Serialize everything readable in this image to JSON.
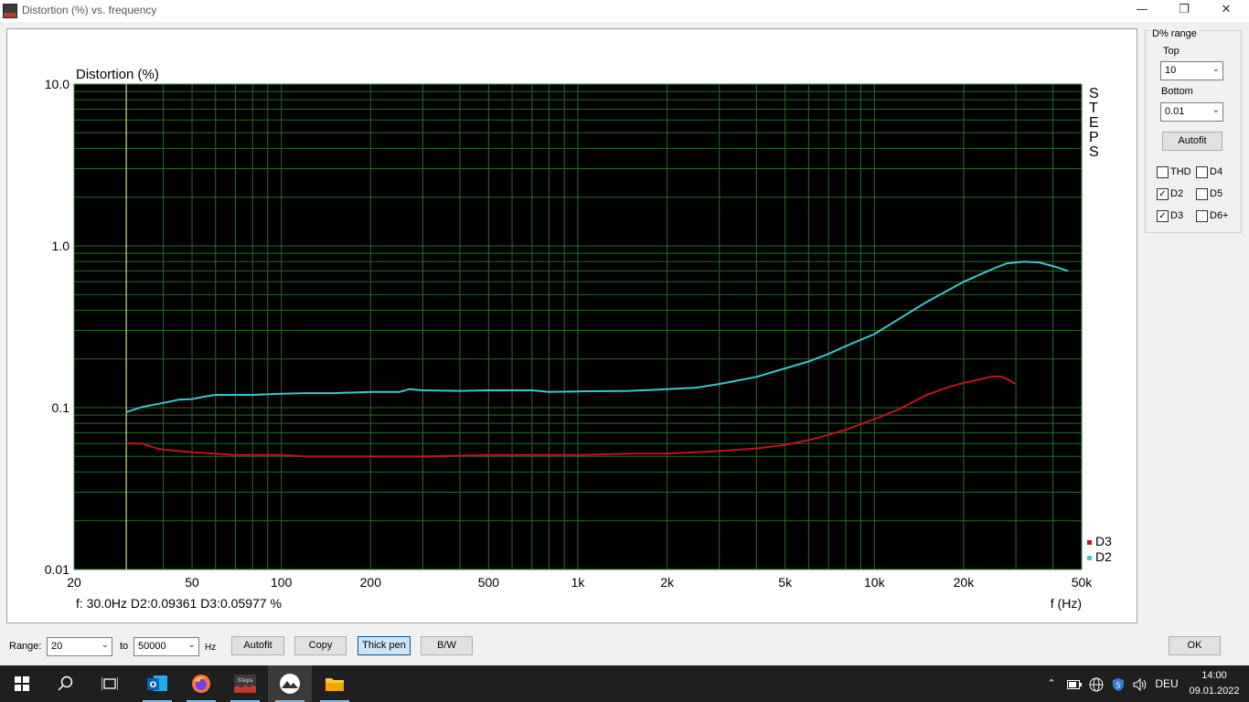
{
  "window": {
    "title": "Distortion (%) vs. frequency",
    "minimize": "—",
    "maximize": "❐",
    "close": "✕"
  },
  "chart_data": {
    "type": "line",
    "title": "Distortion (%)",
    "xlabel": "f (Hz)",
    "ylabel": "Distortion (%)",
    "xscale": "log",
    "yscale": "log",
    "xlim": [
      20,
      50000
    ],
    "ylim": [
      0.01,
      10
    ],
    "x_ticks": [
      20,
      50,
      100,
      200,
      500,
      1000,
      2000,
      5000,
      10000,
      20000,
      50000
    ],
    "x_tick_labels": [
      "20",
      "50",
      "100",
      "200",
      "500",
      "1k",
      "2k",
      "5k",
      "10k",
      "20k",
      "50k"
    ],
    "y_ticks": [
      0.01,
      0.1,
      1,
      10
    ],
    "y_tick_labels": [
      "0.01",
      "0.1",
      "1.0",
      "10.0"
    ],
    "grid": true,
    "background": "#000000",
    "gridcolor": "#2a6b2a",
    "watermark": "STEPS",
    "cursor": {
      "x": 30,
      "readout": "f: 30.0Hz     D2:0.09361   D3:0.05977 %"
    },
    "legend": "bottom-right",
    "series": [
      {
        "name": "D2",
        "color": "#3cc8c8",
        "x": [
          30,
          34,
          40,
          45,
          50,
          55,
          60,
          80,
          100,
          120,
          150,
          200,
          250,
          270,
          300,
          400,
          500,
          700,
          800,
          1000,
          1500,
          2000,
          2500,
          3000,
          4000,
          5000,
          6000,
          7000,
          8000,
          10000,
          12000,
          15000,
          18000,
          20000,
          25000,
          28000,
          32000,
          36000,
          40000,
          45000
        ],
        "values": [
          0.094,
          0.101,
          0.107,
          0.112,
          0.113,
          0.117,
          0.12,
          0.12,
          0.122,
          0.123,
          0.123,
          0.125,
          0.125,
          0.13,
          0.128,
          0.127,
          0.128,
          0.128,
          0.125,
          0.126,
          0.127,
          0.13,
          0.133,
          0.14,
          0.155,
          0.175,
          0.193,
          0.215,
          0.24,
          0.285,
          0.35,
          0.45,
          0.54,
          0.6,
          0.72,
          0.78,
          0.8,
          0.79,
          0.75,
          0.7
        ]
      },
      {
        "name": "D3",
        "color": "#c0141e",
        "x": [
          30,
          34,
          38,
          40,
          45,
          50,
          60,
          70,
          80,
          100,
          120,
          150,
          200,
          300,
          500,
          700,
          1000,
          1500,
          2000,
          2500,
          3000,
          4000,
          5000,
          6000,
          7000,
          8000,
          10000,
          12000,
          15000,
          18000,
          20000,
          22000,
          25000,
          27000,
          29000,
          30000
        ],
        "values": [
          0.06,
          0.06,
          0.056,
          0.055,
          0.054,
          0.053,
          0.052,
          0.051,
          0.051,
          0.051,
          0.05,
          0.05,
          0.05,
          0.05,
          0.051,
          0.051,
          0.051,
          0.052,
          0.052,
          0.053,
          0.054,
          0.056,
          0.059,
          0.063,
          0.068,
          0.073,
          0.085,
          0.097,
          0.12,
          0.135,
          0.142,
          0.148,
          0.156,
          0.155,
          0.145,
          0.14
        ]
      }
    ]
  },
  "panel": {
    "group_title": "D% range",
    "top_label": "Top",
    "top_value": "10",
    "bottom_label": "Bottom",
    "bottom_value": "0.01",
    "autofit": "Autofit",
    "checks": [
      {
        "label": "THD",
        "checked": false
      },
      {
        "label": "D4",
        "checked": false
      },
      {
        "label": "D2",
        "checked": true
      },
      {
        "label": "D5",
        "checked": false
      },
      {
        "label": "D3",
        "checked": true
      },
      {
        "label": "D6+",
        "checked": false
      }
    ]
  },
  "bottom": {
    "range_label": "Range:",
    "range_from": "20",
    "to_label": "to",
    "range_to": "50000",
    "hz_label": "Hz",
    "autofit": "Autofit",
    "copy": "Copy",
    "thick_pen": "Thick pen",
    "bw": "B/W",
    "ok": "OK"
  },
  "taskbar": {
    "time": "14:00",
    "date": "09.01.2022",
    "language": "DEU",
    "tray_badge": "5",
    "accent": "#76b9ed"
  }
}
